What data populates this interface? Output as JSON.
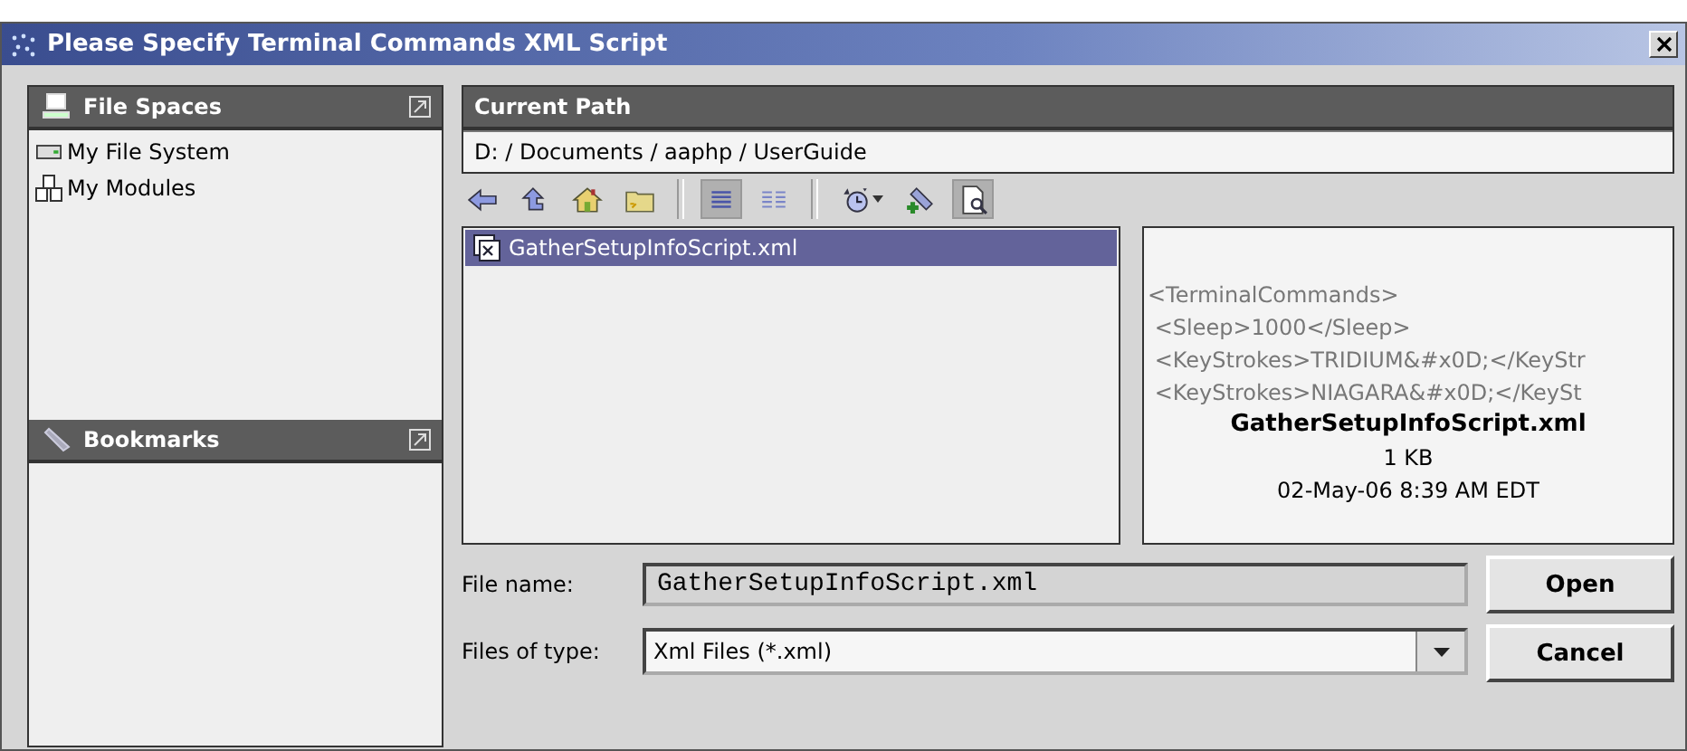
{
  "window": {
    "title": "Please Specify Terminal Commands XML Script"
  },
  "file_spaces": {
    "title": "File Spaces",
    "items": [
      {
        "label": "My File System",
        "kind": "drive"
      },
      {
        "label": "My Modules",
        "kind": "modules"
      }
    ]
  },
  "bookmarks": {
    "title": "Bookmarks"
  },
  "current_path": {
    "title": "Current Path",
    "value": "D: / Documents / aaphp / UserGuide"
  },
  "toolbar": [
    {
      "kind": "back",
      "selected": false
    },
    {
      "kind": "up",
      "selected": false
    },
    {
      "kind": "home",
      "selected": false
    },
    {
      "kind": "new-folder",
      "selected": false
    },
    {
      "kind": "separator"
    },
    {
      "kind": "list-view",
      "selected": true
    },
    {
      "kind": "details-view",
      "selected": false
    },
    {
      "kind": "separator"
    },
    {
      "kind": "history",
      "selected": false
    },
    {
      "kind": "add-bookmark",
      "selected": false
    },
    {
      "kind": "preview",
      "selected": true
    }
  ],
  "files": [
    {
      "name": "GatherSetupInfoScript.xml",
      "selected": true
    }
  ],
  "preview": {
    "lines": [
      "<TerminalCommands>",
      " <Sleep>1000</Sleep>",
      " <KeyStrokes>TRIDIUM&#x0D;</KeyStr",
      " <KeyStrokes>NIAGARA&#x0D;</KeySt"
    ],
    "file_name": "GatherSetupInfoScript.xml",
    "size": "1 KB",
    "modified": "02-May-06 8:39 AM EDT"
  },
  "form": {
    "file_name_label": "File name:",
    "file_name": "GatherSetupInfoScript.xml",
    "type_label": "Files of type:",
    "type": "Xml Files (*.xml)"
  },
  "buttons": [
    "Open",
    "Cancel"
  ]
}
